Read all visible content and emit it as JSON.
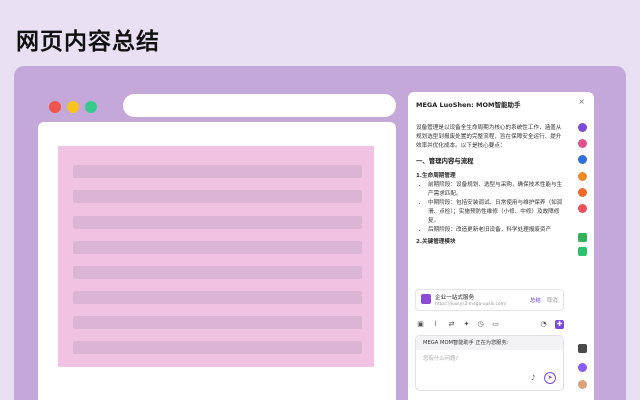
{
  "page": {
    "title": "网页内容总结"
  },
  "panel": {
    "title": "MEGA LuoShen: MOM智能助手",
    "close": "×",
    "intro": "设备管理是以设备全生命周期为核心的系统性工作，涵盖从规划选型到报废处置的完整流程，旨在保障安全运行、提升效率并优化成本。以下是核心要点：",
    "section1": "一、管理内容与流程",
    "sub1": "1.生命周期管理",
    "bullets": [
      "前期阶段：设备规划、选型与采购，确保技术性能与生产需求匹配。",
      "中期阶段：包括安装调试、日常使用与维护保养（如润滑、点检）；实施预防性维修（小修、中修）及故障修复。",
      "后期阶段：改造更新老旧设备，科学处理报废资产"
    ],
    "sub2": "2.关键管理模块"
  },
  "service": {
    "name": "企业一站式服务",
    "url": "https://luosys2.mega-oasis.com/",
    "open": "总结",
    "close": "取消"
  },
  "input": {
    "header": "MEGA MOM智能助手 正在为您服务:",
    "placeholder": "您有什么问题?"
  },
  "icons": {
    "toolbar": [
      "image-icon",
      "attach-icon",
      "translate-icon",
      "magic-icon",
      "clock-icon",
      "chat-icon",
      "history-icon",
      "active-tool-icon"
    ],
    "right_column": [
      "#7b4bd8",
      "#e0508a",
      "#2f6fd8",
      "#f08a24",
      "#f26a2b",
      "#e8505b",
      "#33b05a",
      "#2fc26e",
      "#4a4a4a",
      "#8b5cf6"
    ]
  }
}
